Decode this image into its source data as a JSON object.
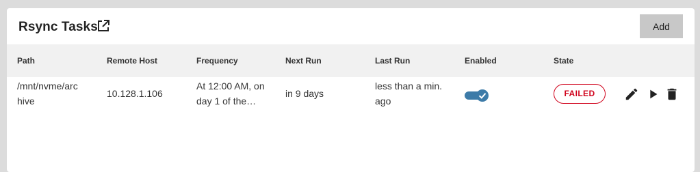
{
  "header": {
    "title": "Rsync Tasks",
    "add_label": "Add"
  },
  "table": {
    "columns": [
      "Path",
      "Remote Host",
      "Frequency",
      "Next Run",
      "Last Run",
      "Enabled",
      "State"
    ],
    "rows": [
      {
        "path_line1": "/mnt/nvme/arc",
        "path_line2": "hive",
        "remote_host": "10.128.1.106",
        "frequency_line1": "At 12:00 AM, on",
        "frequency_line2": "day 1 of the…",
        "next_run": "in 9 days",
        "last_run_line1": "less than a min.",
        "last_run_line2": "ago",
        "enabled": true,
        "state": "FAILED"
      }
    ]
  },
  "icons": {
    "open_in_new": "open-in-new-icon",
    "edit": "pencil-icon",
    "run": "play-icon",
    "delete": "trash-icon"
  },
  "colors": {
    "failed": "#d0021b",
    "toggle_on": "#3d7ba8",
    "add_button_bg": "#c8c8c8",
    "header_row_bg": "#f1f1f1"
  }
}
